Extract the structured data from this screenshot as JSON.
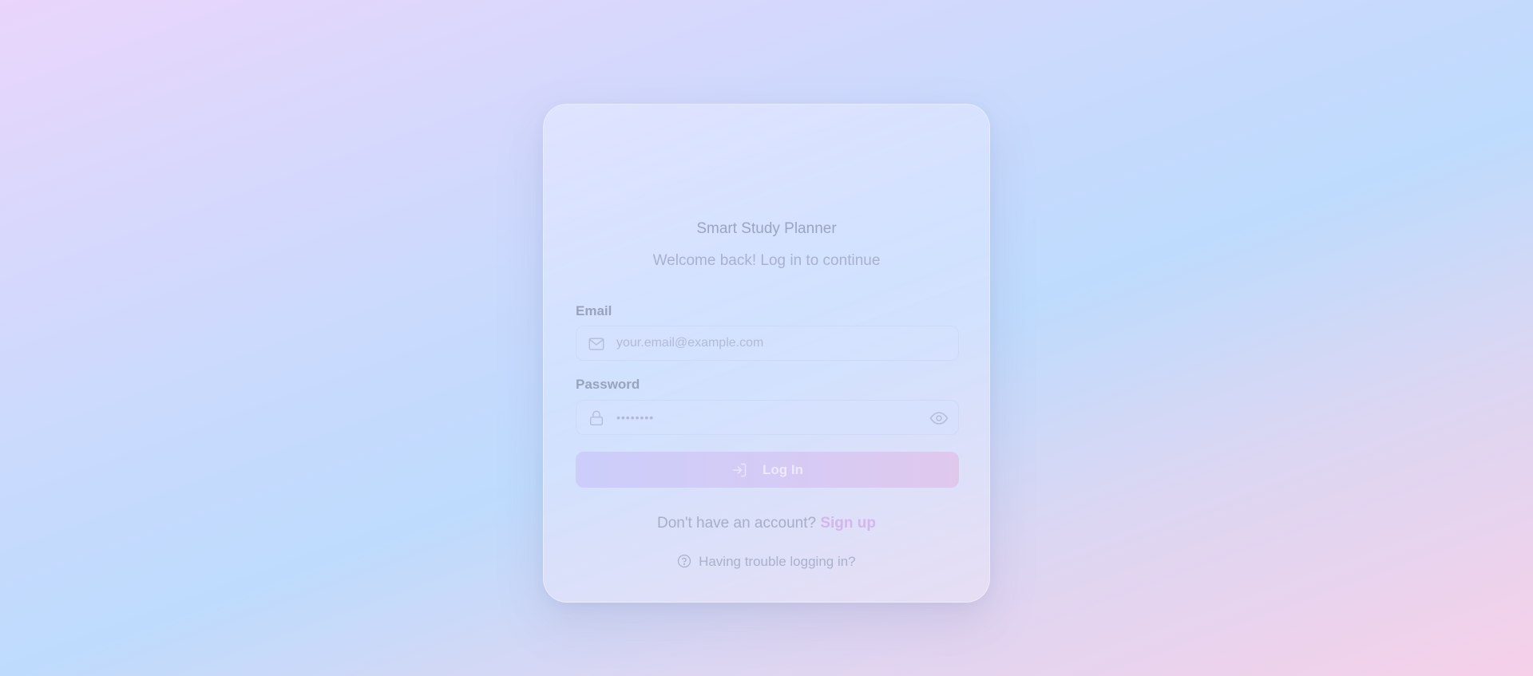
{
  "app": {
    "title": "Smart Study Planner",
    "subtitle": "Welcome back! Log in to continue"
  },
  "form": {
    "email_label": "Email",
    "email_placeholder": "your.email@example.com",
    "email_icon": "mail-icon",
    "password_label": "Password",
    "password_value": "••••••••",
    "password_icon": "lock-icon",
    "password_toggle_icon": "eye-icon",
    "login_label": "Log In",
    "login_icon": "log-in-icon"
  },
  "footer": {
    "signup_prompt": "Don't have an account?",
    "signup_link": "Sign up",
    "trouble_icon": "help-circle-icon",
    "trouble_link": "Having trouble logging in?"
  },
  "colors": {
    "accent_link": "#d4b6ec",
    "button_start": "#cccdfa",
    "button_end": "#e0c8ed"
  }
}
